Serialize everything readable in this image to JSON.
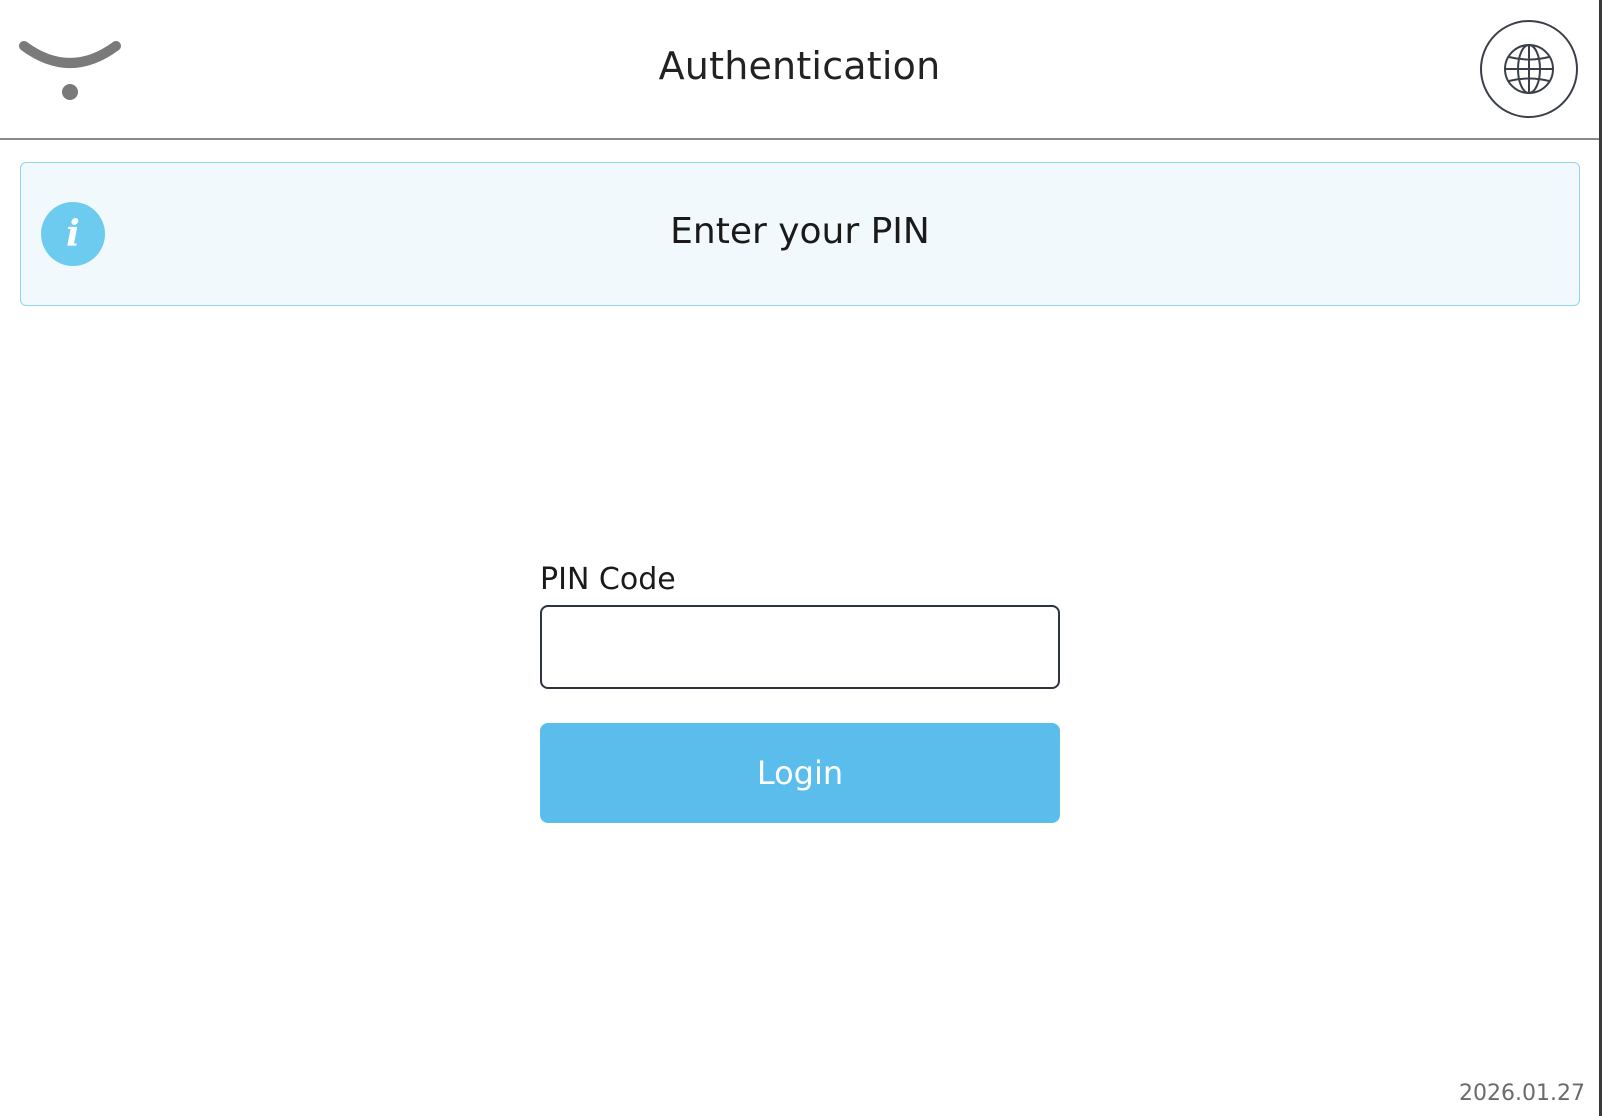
{
  "header": {
    "title": "Authentication",
    "logo_icon": "smile-logo-icon",
    "language_icon": "globe-icon"
  },
  "banner": {
    "icon": "info-icon",
    "icon_glyph": "i",
    "message": "Enter your PIN"
  },
  "form": {
    "pin_label": "PIN Code",
    "pin_value": "",
    "pin_placeholder": "",
    "login_label": "Login"
  },
  "footer": {
    "version": "2026.01.27"
  },
  "colors": {
    "accent": "#5bbdec",
    "info_icon": "#6ccbef",
    "banner_bg": "#f1f9fd",
    "banner_border": "#8fd6ee",
    "logo_gray": "#7a7a7a"
  }
}
